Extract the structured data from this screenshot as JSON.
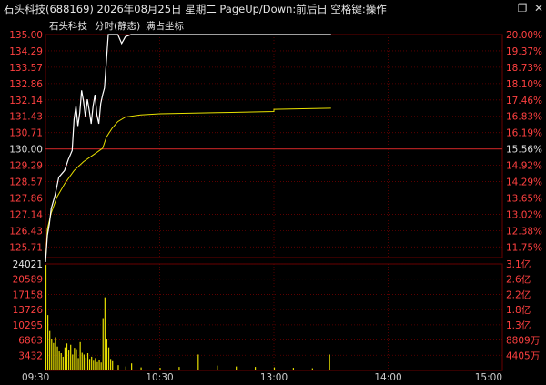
{
  "window": {
    "title": "石头科技(688169) 2026年08月25日 星期二 PageUp/Down:前后日 空格键:操作",
    "close_label": "✕",
    "restore_label": "❐"
  },
  "legend": {
    "stock_name": "石头科技",
    "mode_label": "分时(静态)",
    "scale_label": "满占坐标"
  },
  "colors": {
    "price_line": "#ffffff",
    "avg_line": "#e8e000",
    "volume_bar": "#e8e000",
    "grid": "#6a0000",
    "price_up": "#ff4040",
    "axis_text": "#cccccc",
    "background": "#000000"
  },
  "chart_data": [
    {
      "type": "line",
      "title": "",
      "x_ticks": [
        "09:30",
        "10:30",
        "13:00",
        "14:00",
        "15:00"
      ],
      "y_ticks_left": [
        "135.00",
        "134.29",
        "133.57",
        "132.86",
        "132.14",
        "131.43",
        "130.71",
        "130.00",
        "129.29",
        "128.57",
        "127.86",
        "127.14",
        "126.43",
        "125.71"
      ],
      "y_ticks_right": [
        "20.00%",
        "19.37%",
        "18.73%",
        "18.10%",
        "17.46%",
        "16.83%",
        "16.19%",
        "15.56%",
        "14.92%",
        "14.29%",
        "13.65%",
        "13.02%",
        "12.38%",
        "11.75%"
      ],
      "ylim": [
        125.0,
        135.0
      ],
      "reference_price": 130.0,
      "series": [
        {
          "role": "price",
          "x": [
            "09:30",
            "09:31",
            "09:32",
            "09:33",
            "09:35",
            "09:37",
            "09:40",
            "09:42",
            "09:44",
            "09:45",
            "09:46",
            "09:47",
            "09:48",
            "09:49",
            "09:50",
            "09:51",
            "09:52",
            "09:53",
            "09:54",
            "09:55",
            "09:56",
            "09:57",
            "09:58",
            "09:59",
            "10:00",
            "10:01",
            "10:02",
            "10:03",
            "10:05",
            "10:08",
            "10:10",
            "10:12",
            "10:15",
            "10:20",
            "10:30",
            "11:00",
            "11:30",
            "13:00",
            "13:30"
          ],
          "values": [
            124.8,
            126.0,
            126.5,
            127.2,
            127.8,
            128.6,
            128.9,
            129.4,
            129.8,
            131.2,
            131.8,
            130.9,
            131.5,
            132.5,
            132.0,
            131.3,
            132.1,
            131.6,
            131.0,
            131.8,
            132.3,
            131.4,
            131.0,
            131.9,
            132.3,
            132.6,
            133.8,
            135.0,
            135.0,
            135.0,
            134.6,
            134.9,
            135.0,
            135.0,
            135.0,
            135.0,
            135.0,
            135.0,
            135.0
          ]
        },
        {
          "role": "average",
          "x": [
            "09:30",
            "09:31",
            "09:33",
            "09:36",
            "09:40",
            "09:45",
            "09:50",
            "09:55",
            "10:00",
            "10:02",
            "10:05",
            "10:08",
            "10:12",
            "10:20",
            "10:30",
            "11:00",
            "11:30",
            "13:00",
            "13:30"
          ],
          "values": [
            124.8,
            126.3,
            127.0,
            127.7,
            128.3,
            128.9,
            129.3,
            129.6,
            129.9,
            130.4,
            130.8,
            131.1,
            131.3,
            131.4,
            131.45,
            131.5,
            131.55,
            131.65,
            131.7
          ]
        }
      ]
    },
    {
      "type": "bar",
      "title": "",
      "y_ticks_left": [
        "24021",
        "20589",
        "17158",
        "13726",
        "10295",
        "6863",
        "3432"
      ],
      "y_ticks_right": [
        "3.1亿",
        "2.6亿",
        "2.2亿",
        "1.8亿",
        "1.3亿",
        "8809万",
        "4405万"
      ],
      "ylim": [
        0,
        24021
      ],
      "x": [
        "09:30",
        "09:31",
        "09:32",
        "09:33",
        "09:34",
        "09:35",
        "09:36",
        "09:37",
        "09:38",
        "09:39",
        "09:40",
        "09:41",
        "09:42",
        "09:43",
        "09:44",
        "09:45",
        "09:46",
        "09:47",
        "09:48",
        "09:49",
        "09:50",
        "09:51",
        "09:52",
        "09:53",
        "09:54",
        "09:55",
        "09:56",
        "09:57",
        "09:58",
        "09:59",
        "10:00",
        "10:01",
        "10:02",
        "10:03",
        "10:04",
        "10:05",
        "10:08",
        "10:12",
        "10:15",
        "10:20",
        "10:30",
        "10:40",
        "10:50",
        "11:00",
        "11:10",
        "11:20",
        "13:00",
        "13:10",
        "13:20",
        "13:29"
      ],
      "values": [
        23800,
        12500,
        8900,
        7100,
        6200,
        7500,
        5400,
        4300,
        3900,
        3100,
        5200,
        6100,
        4500,
        5800,
        3600,
        5100,
        4800,
        2800,
        6400,
        4000,
        3600,
        2900,
        3900,
        2600,
        3100,
        2200,
        2800,
        1900,
        2400,
        1800,
        11800,
        16500,
        7100,
        5200,
        2600,
        2100,
        1200,
        900,
        1600,
        700,
        600,
        800,
        3600,
        1100,
        900,
        800,
        700,
        600,
        500,
        3600
      ]
    }
  ]
}
